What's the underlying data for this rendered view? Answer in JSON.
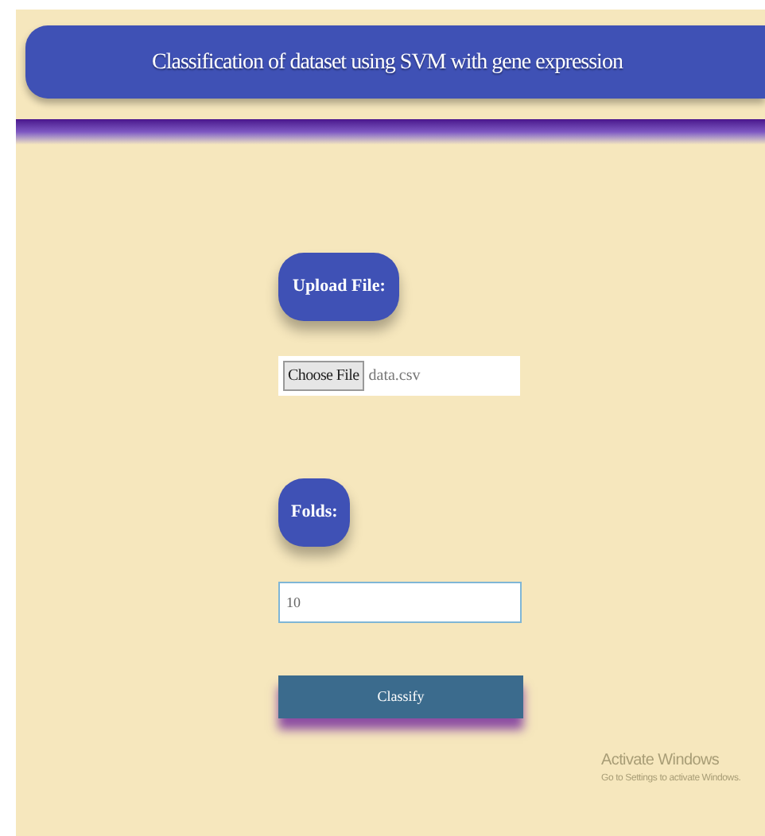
{
  "header": {
    "title": "Classification of dataset using SVM with gene expression"
  },
  "upload": {
    "label": "Upload File:",
    "button": "Choose File",
    "file_name": "data.csv"
  },
  "folds": {
    "label": "Folds:",
    "value": "10"
  },
  "submit": {
    "label": "Classify"
  },
  "os_notice": {
    "title": "Activate Windows",
    "subtitle": "Go to Settings to activate Windows."
  }
}
